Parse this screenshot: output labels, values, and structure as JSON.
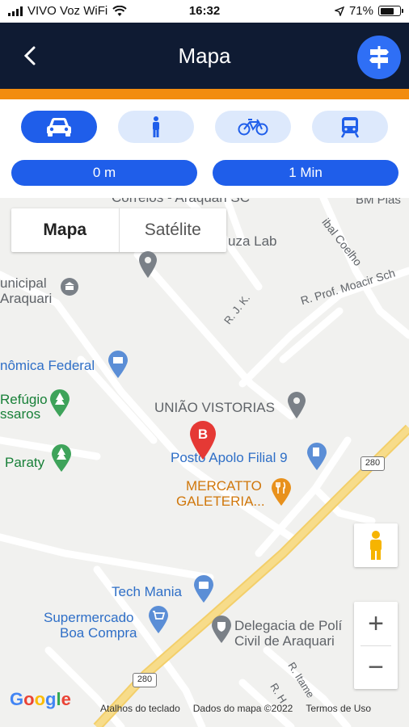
{
  "status": {
    "carrier": "VIVO Voz WiFi",
    "time": "16:32",
    "battery": "71%",
    "battery_level": 0.71
  },
  "header": {
    "back_icon": "chevron-left-icon",
    "title": "Mapa",
    "route_icon": "signpost-icon"
  },
  "colors": {
    "header_bg": "#0f1b33",
    "accent_orange": "#f28c0f",
    "primary_blue": "#1f5eea",
    "mode_inactive": "#dde9fc"
  },
  "modes": {
    "items": [
      {
        "name": "car",
        "icon": "car-icon",
        "active": true
      },
      {
        "name": "walk",
        "icon": "walking-person-icon",
        "active": false
      },
      {
        "name": "bike",
        "icon": "bicycle-icon",
        "active": false
      },
      {
        "name": "transit",
        "icon": "train-icon",
        "active": false
      }
    ],
    "distance": "0 m",
    "duration": "1 Min"
  },
  "map": {
    "type_toggle": {
      "map": "Mapa",
      "satellite": "Satélite"
    },
    "marker_label": "B",
    "labels": {
      "correios": "Correios - Araquari SC",
      "bm": "BM Plas",
      "uza_lab": "uza Lab",
      "anibal": "ibal Coelho",
      "municipal_1": "unicipal",
      "municipal_2": "Araquari",
      "moacir": "R. Prof. Moacir Sch",
      "rjk": "R. J. K.",
      "federal": "nômica Federal",
      "uniao": "UNIÃO VISTORIAS",
      "refugio_1": "Refúgio",
      "refugio_2": "ssaros",
      "paraty": "Paraty",
      "posto": "Posto Apolo Filial 9",
      "road_280_a": "280",
      "mercatto_1": "MERCATTO",
      "mercatto_2": "GALETERIA...",
      "techmania": "Tech Mania",
      "super_1": "Supermercado",
      "super_2": "Boa Compra",
      "delegacia_1": "Delegacia de Polí",
      "delegacia_2": "Civil de Araquari",
      "road_280_b": "280",
      "itame": "R. Itame",
      "rh": "R. H"
    },
    "attribution": {
      "shortcuts": "Atalhos do teclado",
      "data": "Dados do mapa ©2022",
      "terms": "Termos de Uso"
    },
    "google": [
      "G",
      "o",
      "o",
      "g",
      "l",
      "e"
    ]
  }
}
